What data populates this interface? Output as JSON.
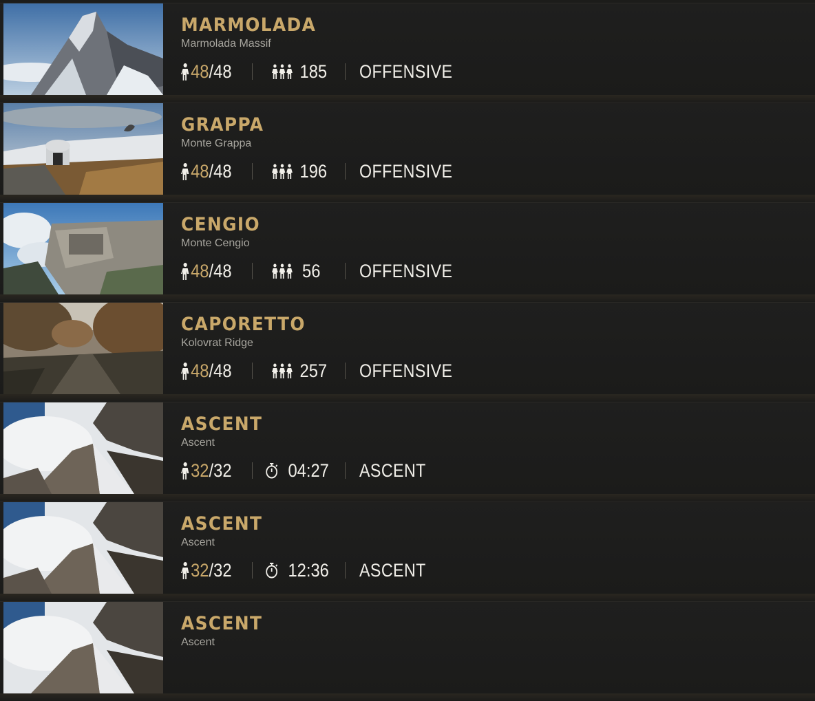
{
  "colors": {
    "background": "#1c1c1a",
    "accent_gold": "#c9a86a",
    "text_primary": "#f1efe9",
    "text_secondary": "#a8a69f"
  },
  "servers": [
    {
      "title": "MARMOLADA",
      "subtitle": "Marmolada Massif",
      "players_current": "48",
      "players_max": "/48",
      "second_icon": "squad-icon",
      "second_value": "185",
      "mode": "OFFENSIVE",
      "thumbnail": "snowy-mountain-peak"
    },
    {
      "title": "GRAPPA",
      "subtitle": "Monte Grappa",
      "players_current": "48",
      "players_max": "/48",
      "second_icon": "squad-icon",
      "second_value": "196",
      "mode": "OFFENSIVE",
      "thumbnail": "hilltop-memorial"
    },
    {
      "title": "CENGIO",
      "subtitle": "Monte Cengio",
      "players_current": "48",
      "players_max": "/48",
      "second_icon": "squad-icon",
      "second_value": "56",
      "mode": "OFFENSIVE",
      "thumbnail": "cliff-fortress"
    },
    {
      "title": "CAPORETTO",
      "subtitle": "Kolovrat Ridge",
      "players_current": "48",
      "players_max": "/48",
      "second_icon": "squad-icon",
      "second_value": "257",
      "mode": "OFFENSIVE",
      "thumbnail": "autumn-forest-trail"
    },
    {
      "title": "ASCENT",
      "subtitle": "Ascent",
      "players_current": "32",
      "players_max": "/32",
      "second_icon": "stopwatch-icon",
      "second_value": "04:27",
      "mode": "ASCENT",
      "thumbnail": "rocky-ridge-clouds"
    },
    {
      "title": "ASCENT",
      "subtitle": "Ascent",
      "players_current": "32",
      "players_max": "/32",
      "second_icon": "stopwatch-icon",
      "second_value": "12:36",
      "mode": "ASCENT",
      "thumbnail": "rocky-ridge-clouds"
    },
    {
      "title": "ASCENT",
      "subtitle": "Ascent",
      "thumbnail": "rocky-ridge-clouds"
    }
  ]
}
